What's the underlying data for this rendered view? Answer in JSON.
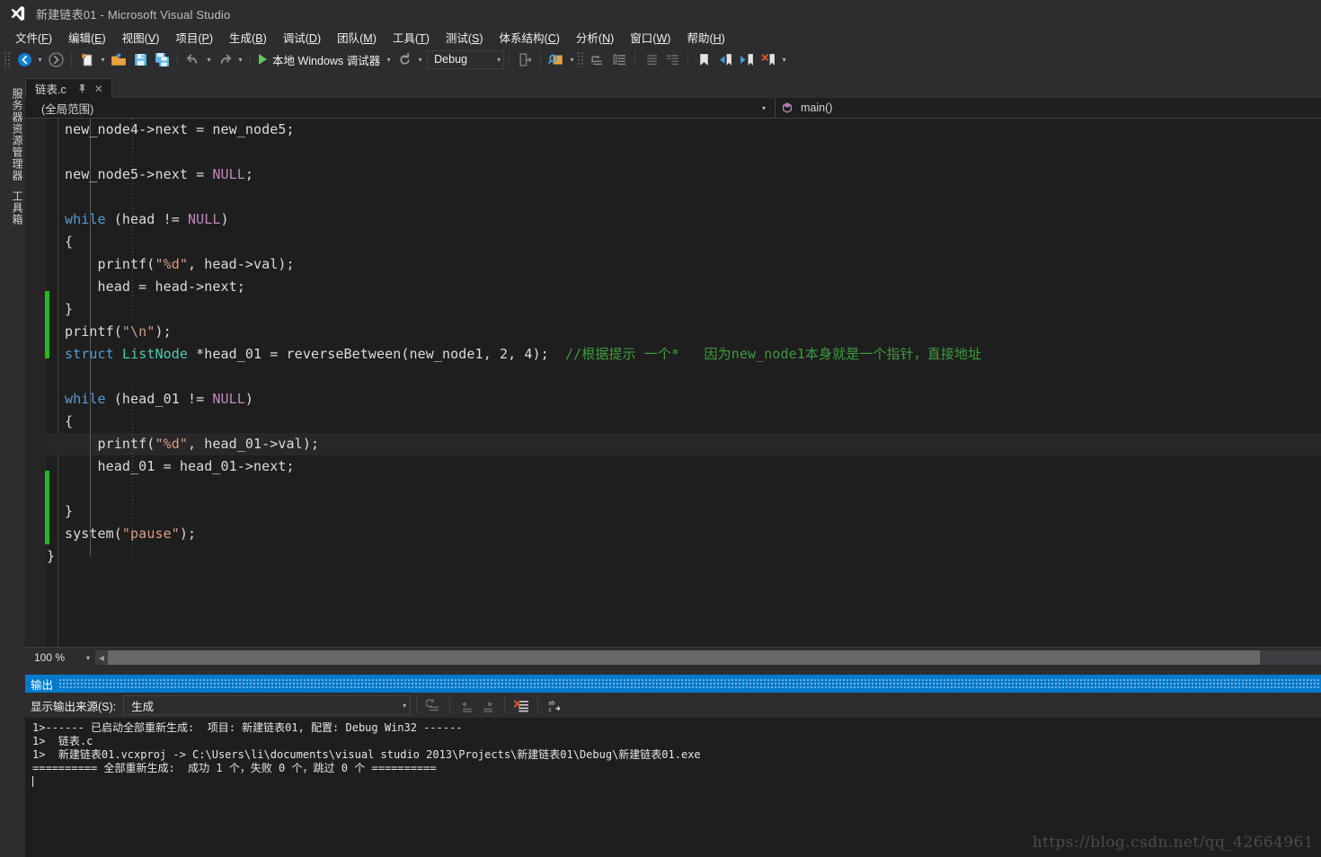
{
  "window": {
    "title": "新建链表01 - Microsoft Visual Studio",
    "logo_name": "visual-studio-logo"
  },
  "menubar": {
    "items": [
      {
        "label": "文件(F)",
        "text": "文件(",
        "mnemonic": "F",
        "tail": ")"
      },
      {
        "label": "编辑(E)",
        "text": "编辑(",
        "mnemonic": "E",
        "tail": ")"
      },
      {
        "label": "视图(V)",
        "text": "视图(",
        "mnemonic": "V",
        "tail": ")"
      },
      {
        "label": "项目(P)",
        "text": "项目(",
        "mnemonic": "P",
        "tail": ")"
      },
      {
        "label": "生成(B)",
        "text": "生成(",
        "mnemonic": "B",
        "tail": ")"
      },
      {
        "label": "调试(D)",
        "text": "调试(",
        "mnemonic": "D",
        "tail": ")"
      },
      {
        "label": "团队(M)",
        "text": "团队(",
        "mnemonic": "M",
        "tail": ")"
      },
      {
        "label": "工具(T)",
        "text": "工具(",
        "mnemonic": "T",
        "tail": ")"
      },
      {
        "label": "测试(S)",
        "text": "测试(",
        "mnemonic": "S",
        "tail": ")"
      },
      {
        "label": "体系结构(C)",
        "text": "体系结构(",
        "mnemonic": "C",
        "tail": ")"
      },
      {
        "label": "分析(N)",
        "text": "分析(",
        "mnemonic": "N",
        "tail": ")"
      },
      {
        "label": "窗口(W)",
        "text": "窗口(",
        "mnemonic": "W",
        "tail": ")"
      },
      {
        "label": "帮助(H)",
        "text": "帮助(",
        "mnemonic": "H",
        "tail": ")"
      }
    ]
  },
  "toolbar": {
    "navigate_back": "navigate-back-icon",
    "navigate_forward": "navigate-forward-icon",
    "new_item": "new-item-icon",
    "open_file": "open-file-icon",
    "save": "save-icon",
    "save_all": "save-all-icon",
    "undo": "undo-icon",
    "redo": "redo-icon",
    "start_debug_label": "本地 Windows 调试器",
    "restart_icon": "restart-icon",
    "configuration": "Debug",
    "step_into_icon": "step-into-icon",
    "find_icon": "find-in-files-icon",
    "comment_icon": "comment-selection-icon",
    "uncomment_icon": "uncomment-selection-icon",
    "indent_icon": "increase-indent-icon",
    "outdent_icon": "decrease-indent-icon",
    "bookmark_icon": "toggle-bookmark-icon",
    "prev_bookmark_icon": "previous-bookmark-icon",
    "next_bookmark_icon": "next-bookmark-icon",
    "clear_bookmarks_icon": "clear-bookmarks-icon"
  },
  "left_dock": {
    "tabs": [
      {
        "label": "服务器资源管理器"
      },
      {
        "label": "工具箱"
      }
    ]
  },
  "editor": {
    "tab": {
      "filename": "链表.c",
      "pin_icon": "pin-icon",
      "close_icon": "close-icon"
    },
    "nav": {
      "scope": "(全局范围)",
      "member": "main()",
      "member_icon": "method-icon"
    },
    "zoom": "100 %",
    "code_lines": [
      "        new_node4->next = new_node5;",
      "",
      "        new_node5->next = NULL;",
      "",
      "        while (head != NULL)",
      "        {",
      "            printf(\"%d\", head->val);",
      "            head = head->next;",
      "        }",
      "        printf(\"\\n\");",
      "        struct ListNode *head_01 = reverseBetween(new_node1, 2, 4);  //根据提示 一个*   因为new_node1本身就是一个指针，直接地址",
      "",
      "        while (head_01 != NULL)",
      "        {",
      "            printf(\"%d\", head_01->val);",
      "            head_01 = head_01->next;",
      "",
      "        }",
      "        system(\"pause\");",
      "    }"
    ],
    "comment_text": "//根据提示 一个*   因为new_node1本身就是一个指针，直接地址"
  },
  "output_panel": {
    "title": "输出",
    "source_label": "显示输出来源(S):",
    "source_value": "生成",
    "buttons": {
      "goto_message": "go-to-message-icon",
      "prev_message": "previous-message-icon",
      "next_message": "next-message-icon",
      "clear_all": "clear-all-icon",
      "toggle_wordwrap": "toggle-word-wrap-icon"
    },
    "lines": [
      "1>------ 已启动全部重新生成:  项目: 新建链表01, 配置: Debug Win32 ------",
      "1>  链表.c",
      "1>  新建链表01.vcxproj -> C:\\Users\\li\\documents\\visual studio 2013\\Projects\\新建链表01\\Debug\\新建链表01.exe",
      "========== 全部重新生成:  成功 1 个，失败 0 个，跳过 0 个 =========="
    ]
  },
  "watermark": {
    "text": "https://blog.csdn.net/qq_42664961"
  },
  "colors": {
    "accent": "#007acc",
    "chrome": "#2d2d30",
    "editor_bg": "#1e1e1e",
    "keyword": "#569cd6",
    "macro": "#c586c0",
    "string": "#d69d85",
    "type": "#4ec9b0",
    "comment": "#3f9a3f",
    "changebar_saved": "#1bbd1b"
  }
}
